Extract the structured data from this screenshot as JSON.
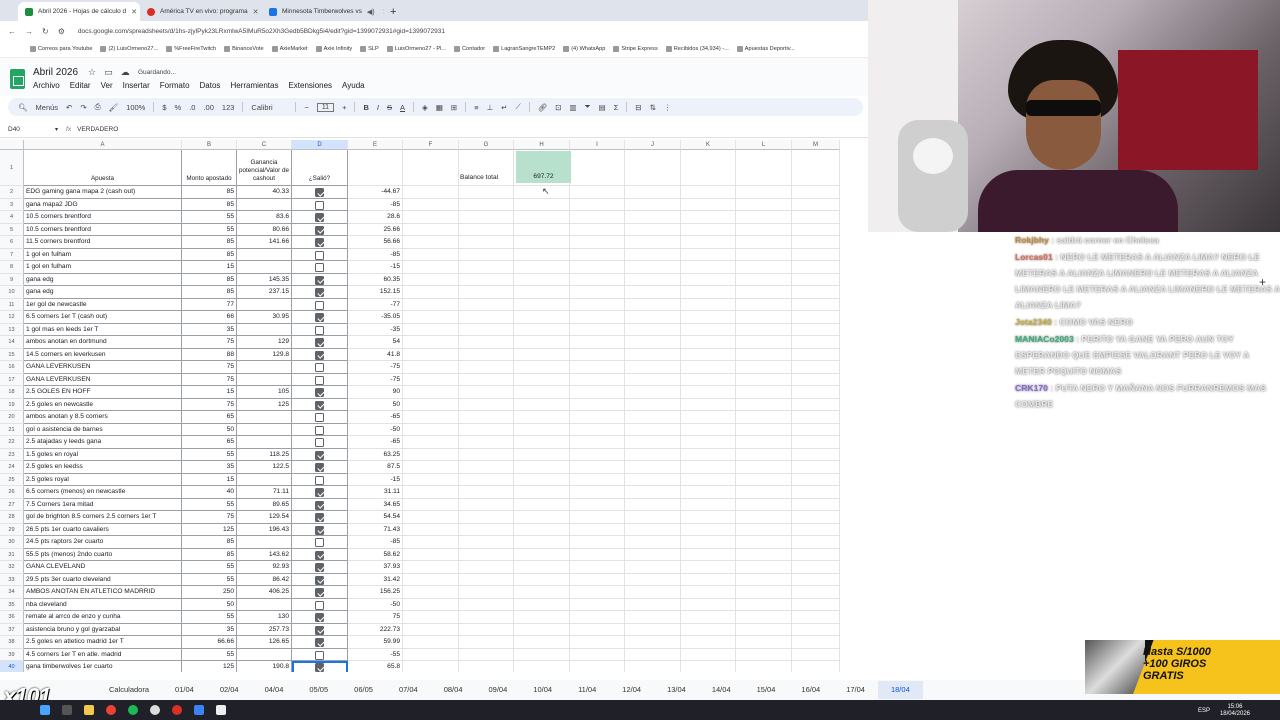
{
  "browser": {
    "tabs": [
      {
        "title": "Abril 2026 - Hojas de cálculo d",
        "color": "#1e8e3e",
        "active": true
      },
      {
        "title": "América TV en vivo: programa",
        "color": "#d93025",
        "active": false
      },
      {
        "title": "Minnesota Timberwolves vs",
        "color": "#1a73e8",
        "active": false
      }
    ],
    "new_tab": "+",
    "url": "docs.google.com/spreadsheets/d/1hs-zjylPyk23LRxmlwA5IMuR5o2Xh3Gedb5BDkg5i4/edit?gid=1399072931#gid=1399072931",
    "bookmarks": [
      "Correos para Youtube",
      "(2) LuisOrmeno27...",
      "%FreeFireTwitch",
      "BinanceVote",
      "AxieMarket",
      "Axie Infinity",
      "SLP",
      "LuisOrmeno27 - Pl...",
      "Contador",
      "LagranSangreTEMP2",
      "(4) WhatsApp",
      "Stripe Express",
      "Recibidos (34,934) -...",
      "Apuestas Deportiv..."
    ]
  },
  "sheets": {
    "doc_title": "Abril 2026",
    "saving": "Guardando...",
    "menu": [
      "Archivo",
      "Editar",
      "Ver",
      "Insertar",
      "Formato",
      "Datos",
      "Herramientas",
      "Extensiones",
      "Ayuda"
    ],
    "toolbar": {
      "menus": "Menús",
      "zoom": "100%",
      "currency": "$",
      "percent": "%",
      "format": "123",
      "font": "Calibri",
      "font_size": "11"
    },
    "name_box": "D40",
    "formula": "VERDADERO",
    "columns": [
      "A",
      "B",
      "C",
      "D",
      "E",
      "F",
      "G",
      "H",
      "I",
      "J",
      "K",
      "L",
      "M"
    ],
    "headers": {
      "a": "Apuesta",
      "b": "Monto apostado",
      "c": "Ganancia potencial/Valor de cashout",
      "d": "¿Salió?"
    },
    "balance_label": "Balance total",
    "balance_value": "697.72",
    "rows": [
      {
        "n": "2",
        "a": "EDG gaming gana mapa 2 (cash out)",
        "b": "85",
        "c": "40.33",
        "d": true,
        "e": "-44.67"
      },
      {
        "n": "3",
        "a": "gana mapa2 JDG",
        "b": "85",
        "c": "",
        "d": false,
        "e": "-85"
      },
      {
        "n": "4",
        "a": "10.5 corners brentford",
        "b": "55",
        "c": "83.6",
        "d": true,
        "e": "28.6"
      },
      {
        "n": "5",
        "a": "10.5 corners brentford",
        "b": "55",
        "c": "80.66",
        "d": true,
        "e": "25.66"
      },
      {
        "n": "6",
        "a": "11.5 corners brentford",
        "b": "85",
        "c": "141.66",
        "d": true,
        "e": "56.66"
      },
      {
        "n": "7",
        "a": "1 gol en fulham",
        "b": "85",
        "c": "",
        "d": false,
        "e": "-85"
      },
      {
        "n": "8",
        "a": "1 gol en fulham",
        "b": "15",
        "c": "",
        "d": false,
        "e": "-15"
      },
      {
        "n": "9",
        "a": "gana edg",
        "b": "85",
        "c": "145.35",
        "d": true,
        "e": "60.35"
      },
      {
        "n": "10",
        "a": "gana edg",
        "b": "85",
        "c": "237.15",
        "d": true,
        "e": "152.15"
      },
      {
        "n": "11",
        "a": "1er gol de newcastle",
        "b": "77",
        "c": "",
        "d": false,
        "e": "-77"
      },
      {
        "n": "12",
        "a": "6.5 corners 1er T (cash out)",
        "b": "66",
        "c": "30.95",
        "d": true,
        "e": "-35.05"
      },
      {
        "n": "13",
        "a": "1 gol mas en leeds 1er T",
        "b": "35",
        "c": "",
        "d": false,
        "e": "-35"
      },
      {
        "n": "14",
        "a": "ambos anotan en dortmund",
        "b": "75",
        "c": "129",
        "d": true,
        "e": "54"
      },
      {
        "n": "15",
        "a": "14.5 corners en leverkusen",
        "b": "88",
        "c": "129.8",
        "d": true,
        "e": "41.8"
      },
      {
        "n": "16",
        "a": "GANA LEVERKUSEN",
        "b": "75",
        "c": "",
        "d": false,
        "e": "-75"
      },
      {
        "n": "17",
        "a": "GANA LEVERKUSEN",
        "b": "75",
        "c": "",
        "d": false,
        "e": "-75"
      },
      {
        "n": "18",
        "a": "2.5 GOLES EN HOFF",
        "b": "15",
        "c": "105",
        "d": true,
        "e": "90"
      },
      {
        "n": "19",
        "a": "2.5 goles en newcastle",
        "b": "75",
        "c": "125",
        "d": true,
        "e": "50"
      },
      {
        "n": "20",
        "a": "ambos anotan y 8.5 corners",
        "b": "65",
        "c": "",
        "d": false,
        "e": "-65"
      },
      {
        "n": "21",
        "a": "gol o asistencia de barnes",
        "b": "50",
        "c": "",
        "d": false,
        "e": "-50"
      },
      {
        "n": "22",
        "a": "2.5 atajadas y leeds gana",
        "b": "65",
        "c": "",
        "d": false,
        "e": "-65"
      },
      {
        "n": "23",
        "a": "1.5 goles en royal",
        "b": "55",
        "c": "118.25",
        "d": true,
        "e": "63.25"
      },
      {
        "n": "24",
        "a": "2.5 goles en leedss",
        "b": "35",
        "c": "122.5",
        "d": true,
        "e": "87.5"
      },
      {
        "n": "25",
        "a": "2.5 goles royal",
        "b": "15",
        "c": "",
        "d": false,
        "e": "-15"
      },
      {
        "n": "26",
        "a": "6.5 corners (menos) en newcastle",
        "b": "40",
        "c": "71.11",
        "d": true,
        "e": "31.11"
      },
      {
        "n": "27",
        "a": "7.5 Corners 1era mitad",
        "b": "55",
        "c": "89.65",
        "d": true,
        "e": "34.65"
      },
      {
        "n": "28",
        "a": "gol de brighton 8.5 corners 2.5 corners 1er T",
        "b": "75",
        "c": "129.54",
        "d": true,
        "e": "54.54"
      },
      {
        "n": "29",
        "a": "26.5 pts 1er cuarto cavaliers",
        "b": "125",
        "c": "196.43",
        "d": true,
        "e": "71.43"
      },
      {
        "n": "30",
        "a": "24.5 pts raptors 2er cuarto",
        "b": "85",
        "c": "",
        "d": false,
        "e": "-85"
      },
      {
        "n": "31",
        "a": "55.5 pts (menos) 2ndo cuarto",
        "b": "85",
        "c": "143.62",
        "d": true,
        "e": "58.62"
      },
      {
        "n": "32",
        "a": "GANA CLEVELAND",
        "b": "55",
        "c": "92.93",
        "d": true,
        "e": "37.93"
      },
      {
        "n": "33",
        "a": "29.5 pts 3er cuarto cleveland",
        "b": "55",
        "c": "86.42",
        "d": true,
        "e": "31.42"
      },
      {
        "n": "34",
        "a": "AMBOS ANOTAN EN ATLETICO MADRRID",
        "b": "250",
        "c": "406.25",
        "d": true,
        "e": "156.25"
      },
      {
        "n": "35",
        "a": "nba cleveland",
        "b": "50",
        "c": "",
        "d": false,
        "e": "-50"
      },
      {
        "n": "36",
        "a": "remate al arrco de enzo y cunha",
        "b": "55",
        "c": "130",
        "d": true,
        "e": "75"
      },
      {
        "n": "37",
        "a": "asistencia bruno y gol gyarzabal",
        "b": "35",
        "c": "257.73",
        "d": true,
        "e": "222.73"
      },
      {
        "n": "38",
        "a": "2.5 goles en atletico madrid 1er T",
        "b": "66.66",
        "c": "126.65",
        "d": true,
        "e": "59.99"
      },
      {
        "n": "39",
        "a": "4.5 corners 1er T en atle. madrid",
        "b": "55",
        "c": "",
        "d": false,
        "e": "-55"
      },
      {
        "n": "40",
        "a": "gana timberwolves 1er cuarto",
        "b": "125",
        "c": "190.8",
        "d": true,
        "e": "65.8"
      }
    ],
    "sheet_tabs": [
      "Calculadora",
      "01/04",
      "02/04",
      "04/04",
      "05/05",
      "06/05",
      "07/04",
      "08/04",
      "09/04",
      "10/04",
      "11/04",
      "12/04",
      "13/04",
      "14/04",
      "15/04",
      "16/04",
      "17/04",
      "18/04"
    ],
    "active_sheet": "18/04"
  },
  "overlay": {
    "brand": "x101",
    "chat": [
      {
        "user": "Rokjbhy",
        "user_color": "#c98a3a",
        "text": "saldrá corner en Chelsea"
      },
      {
        "user": "Lorcas01",
        "user_color": "#e06a5a",
        "text": "NERO LE METERAS A ALIANZA LIMA? NERO LE METERAS A ALIANZA LIMANERO LE METERAS A ALIANZA LIMANERO LE METERAS A ALIANZA LIMANERO LE METERAS A ALIANZA LIMA?"
      },
      {
        "user": "Jota2340",
        "user_color": "#c9b23a",
        "text": "COMO VAS NERO"
      },
      {
        "user": "MANIACo2003",
        "user_color": "#3ab07a",
        "text": "PERITO YA GANE YA PERO AUN TOY ESPERANDO QUE EMPIESE VALORANT PERO LE VOY A METER POQUITO NOMAS"
      },
      {
        "user": "CRK170",
        "user_color": "#8a6ad9",
        "text": "PUTA NERO Y MAÑANA NOS FURRANREMOS MAS COMBRE"
      }
    ],
    "ad": {
      "line1": "Hasta S/1000",
      "line2": "+100 GIROS",
      "line3": "GRATIS"
    },
    "tray": {
      "lang": "ESP",
      "time": "15:06",
      "date": "18/04/2026"
    }
  }
}
